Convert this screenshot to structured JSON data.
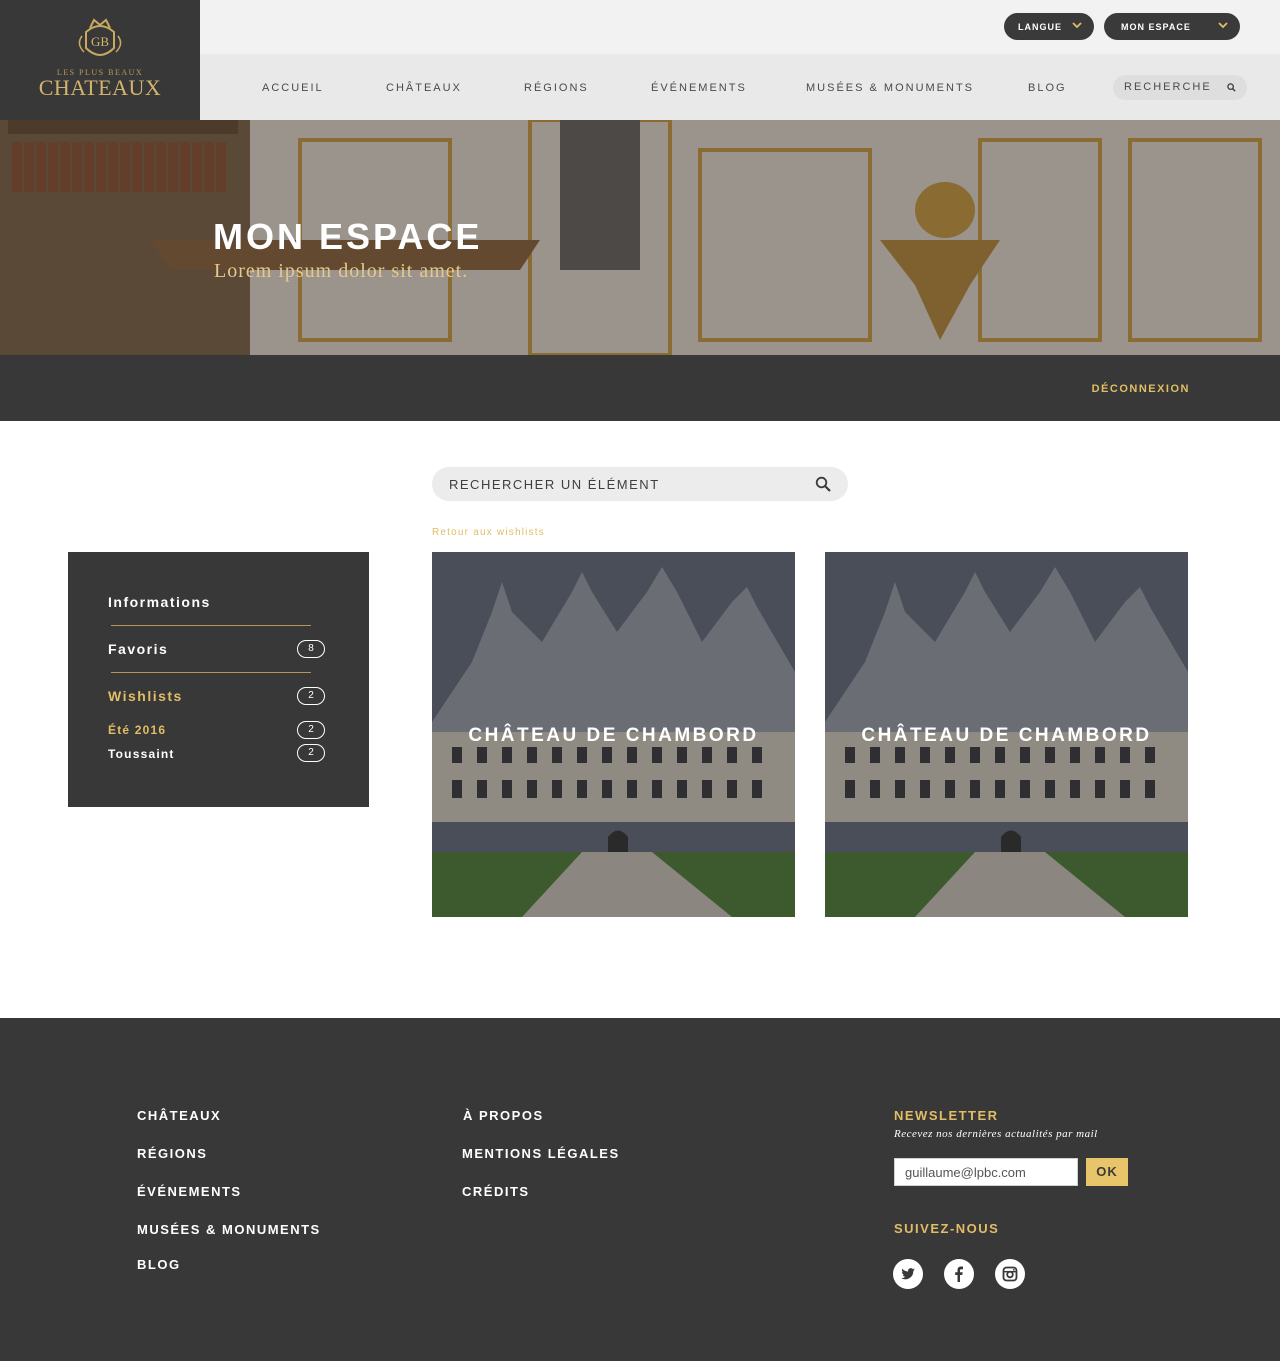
{
  "logo": {
    "monogram": "GB",
    "line1": "LES PLUS BEAUX",
    "line2": "CHATEAUX"
  },
  "topbar": {
    "language_label": "LANGUE",
    "account_label": "MON ESPACE"
  },
  "nav": {
    "items": [
      {
        "label": "ACCUEIL"
      },
      {
        "label": "CHÂTEAUX"
      },
      {
        "label": "RÉGIONS"
      },
      {
        "label": "ÉVÉNEMENTS"
      },
      {
        "label": "MUSÉES & MONUMENTS"
      },
      {
        "label": "BLOG"
      }
    ],
    "search_label": "RECHERCHE"
  },
  "hero": {
    "title": "MON ESPACE",
    "subtitle": "Lorem ipsum dolor sit amet."
  },
  "account_bar": {
    "logout_label": "DÉCONNEXION"
  },
  "main": {
    "search_placeholder": "RECHERCHER UN ÉLÉMENT",
    "back_link": "Retour aux wishlists"
  },
  "sidebar": {
    "heading": "Informations",
    "favoris": {
      "label": "Favoris",
      "count": "8"
    },
    "wishlists": {
      "label": "Wishlists",
      "count": "2"
    },
    "lists": [
      {
        "label": "Été 2016",
        "count": "2"
      },
      {
        "label": "Toussaint",
        "count": "2"
      }
    ]
  },
  "cards": [
    {
      "title": "CHÂTEAU DE CHAMBORD"
    },
    {
      "title": "CHÂTEAU DE CHAMBORD"
    }
  ],
  "footer": {
    "col1": [
      "CHÂTEAUX",
      "RÉGIONS",
      "ÉVÉNEMENTS",
      "MUSÉES & MONUMENTS",
      "BLOG"
    ],
    "col2": [
      "À PROPOS",
      "MENTIONS LÉGALES",
      "CRÉDITS"
    ],
    "newsletter_heading": "NEWSLETTER",
    "newsletter_note": "Recevez nos dernières actualités par mail",
    "newsletter_value": "guillaume@lpbc.com",
    "newsletter_button": "OK",
    "follow_heading": "SUIVEZ-NOUS",
    "socials": [
      "twitter-icon",
      "facebook-icon",
      "instagram-icon"
    ]
  },
  "colors": {
    "dark": "#383838",
    "gold": "#e2bd66",
    "light_bg": "#f2f2f2",
    "nav_bg": "#e9e9e9"
  }
}
